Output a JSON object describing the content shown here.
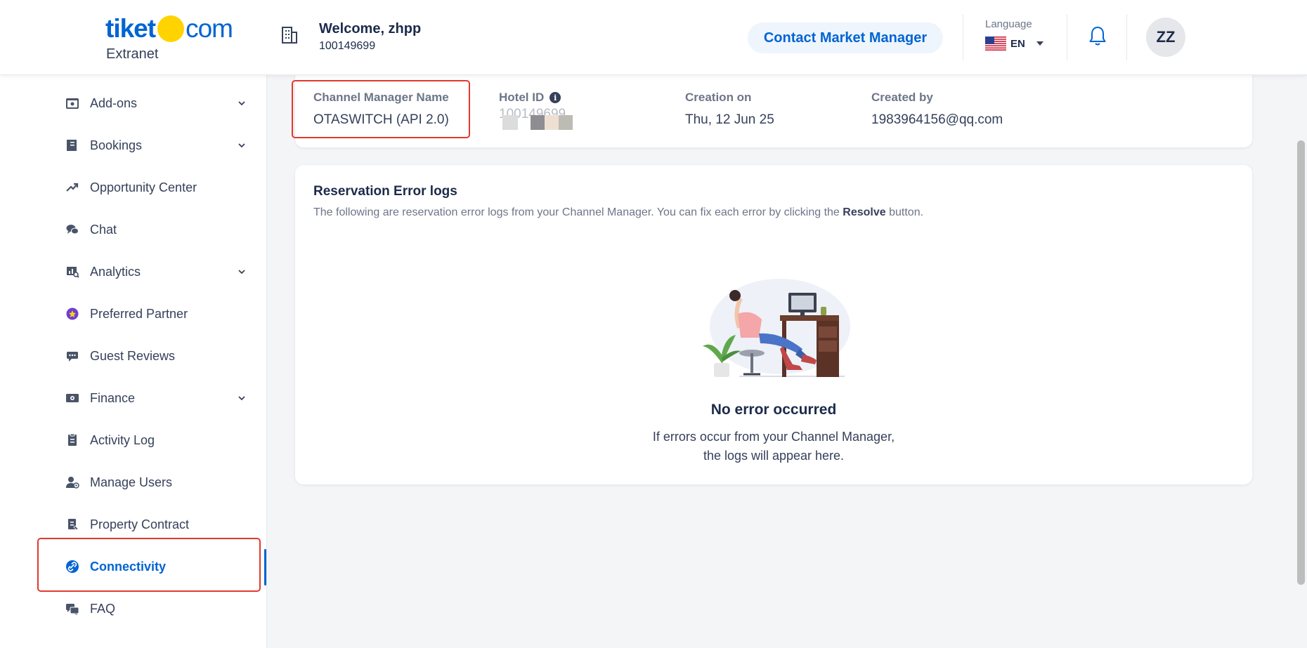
{
  "header": {
    "logo_text": "tiket",
    "logo_com": "com",
    "logo_sub": "Extranet",
    "welcome": "Welcome, zhpp",
    "hotel_code": "100149699",
    "contact_button": "Contact Market Manager",
    "language_label": "Language",
    "language_code": "EN",
    "avatar_initials": "ZZ"
  },
  "sidebar": {
    "items": [
      {
        "label": "Add-ons",
        "icon": "addons-icon",
        "expandable": true
      },
      {
        "label": "Bookings",
        "icon": "bookings-icon",
        "expandable": true
      },
      {
        "label": "Opportunity Center",
        "icon": "trend-icon",
        "expandable": false
      },
      {
        "label": "Chat",
        "icon": "chat-icon",
        "expandable": false
      },
      {
        "label": "Analytics",
        "icon": "analytics-icon",
        "expandable": true
      },
      {
        "label": "Preferred Partner",
        "icon": "badge-icon",
        "expandable": false
      },
      {
        "label": "Guest Reviews",
        "icon": "review-icon",
        "expandable": false
      },
      {
        "label": "Finance",
        "icon": "finance-icon",
        "expandable": true
      },
      {
        "label": "Activity Log",
        "icon": "activity-log-icon",
        "expandable": false
      },
      {
        "label": "Manage Users",
        "icon": "user-icon",
        "expandable": false
      },
      {
        "label": "Property Contract",
        "icon": "contract-icon",
        "expandable": false
      },
      {
        "label": "Connectivity",
        "icon": "link-icon",
        "expandable": false,
        "active": true
      },
      {
        "label": "FAQ",
        "icon": "faq-icon",
        "expandable": false
      }
    ]
  },
  "info": {
    "channel_manager_label": "Channel Manager Name",
    "channel_manager_value": "OTASWITCH (API 2.0)",
    "hotel_id_label": "Hotel ID",
    "hotel_id_value": "100149699",
    "creation_label": "Creation on",
    "creation_value": "Thu, 12 Jun 25",
    "created_by_label": "Created by",
    "created_by_value": "1983964156@qq.com"
  },
  "error_logs": {
    "title": "Reservation Error logs",
    "desc_prefix": "The following are reservation error logs from your Channel Manager. You can fix each error by clicking the ",
    "desc_bold": "Resolve",
    "desc_suffix": " button.",
    "empty_title": "No error occurred",
    "empty_line1": "If errors occur from your Channel Manager,",
    "empty_line2": "the logs will appear here."
  },
  "colors": {
    "brand_blue": "#0064d2",
    "logo_yellow": "#ffd300",
    "highlight_red": "#e03a2e"
  }
}
